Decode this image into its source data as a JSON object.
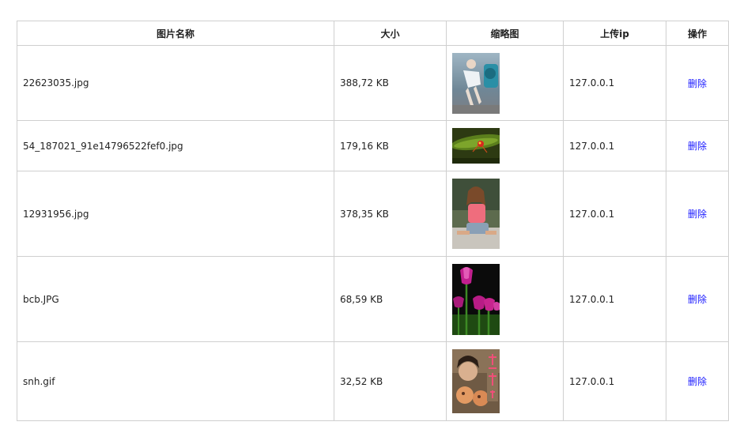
{
  "table": {
    "headers": {
      "name": "图片名称",
      "size": "大小",
      "thumbnail": "缩略图",
      "ip": "上传ip",
      "action": "操作"
    },
    "rows": [
      {
        "name": "22623035.jpg",
        "size": "388,72 KB",
        "ip": "127.0.0.1",
        "action": "删除",
        "thumbnail_icon": "woman-photo-thumbnail"
      },
      {
        "name": "54_187021_91e14796522fef0.jpg",
        "size": "179,16 KB",
        "ip": "127.0.0.1",
        "action": "删除",
        "thumbnail_icon": "insect-leaf-thumbnail"
      },
      {
        "name": "12931956.jpg",
        "size": "378,35 KB",
        "ip": "127.0.0.1",
        "action": "删除",
        "thumbnail_icon": "woman-pink-top-thumbnail"
      },
      {
        "name": "bcb.JPG",
        "size": "68,59 KB",
        "ip": "127.0.0.1",
        "action": "删除",
        "thumbnail_icon": "tulips-thumbnail"
      },
      {
        "name": "snh.gif",
        "size": "32,52 KB",
        "ip": "127.0.0.1",
        "action": "删除",
        "thumbnail_icon": "girls-photo-thumbnail"
      }
    ]
  },
  "colors": {
    "link": "#1a1aff",
    "border": "#cfcfcf"
  }
}
